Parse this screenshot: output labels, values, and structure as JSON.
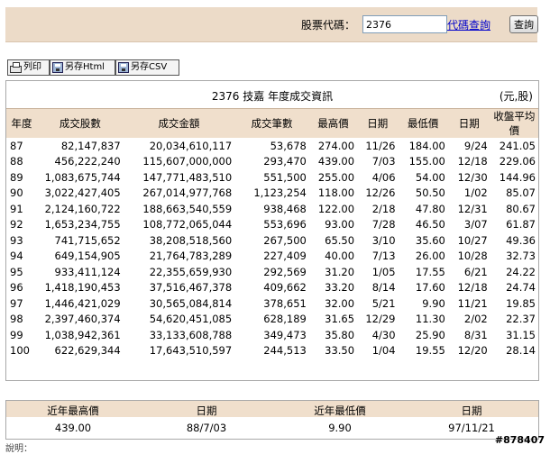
{
  "query": {
    "label": "股票代碼：",
    "value": "2376",
    "lookup_link": "代碼查詢",
    "submit": "查詢"
  },
  "toolbar": {
    "print": "列印",
    "save_html": "另存Html",
    "save_csv": "另存CSV"
  },
  "table": {
    "title": "2376 技嘉 年度成交資訊",
    "unit": "(元,股)",
    "columns": [
      "年度",
      "成交股數",
      "成交金額",
      "成交筆數",
      "最高價",
      "日期",
      "最低價",
      "日期",
      "收盤平均價"
    ],
    "rows": [
      [
        "87",
        "82,147,837",
        "20,034,610,117",
        "53,678",
        "274.00",
        "11/26",
        "184.00",
        "9/24",
        "241.05"
      ],
      [
        "88",
        "456,222,240",
        "115,607,000,000",
        "293,470",
        "439.00",
        "7/03",
        "155.00",
        "12/18",
        "229.06"
      ],
      [
        "89",
        "1,083,675,744",
        "147,771,483,510",
        "551,500",
        "255.00",
        "4/06",
        "54.00",
        "12/30",
        "144.96"
      ],
      [
        "90",
        "3,022,427,405",
        "267,014,977,768",
        "1,123,254",
        "118.00",
        "12/26",
        "50.50",
        "1/02",
        "85.07"
      ],
      [
        "91",
        "2,124,160,722",
        "188,663,540,559",
        "938,468",
        "122.00",
        "2/18",
        "47.80",
        "12/31",
        "80.67"
      ],
      [
        "92",
        "1,653,234,755",
        "108,772,065,044",
        "553,696",
        "93.00",
        "7/28",
        "46.50",
        "3/07",
        "61.87"
      ],
      [
        "93",
        "741,715,652",
        "38,208,518,560",
        "267,500",
        "65.50",
        "3/10",
        "35.60",
        "10/27",
        "49.36"
      ],
      [
        "94",
        "649,154,905",
        "21,764,783,289",
        "227,409",
        "40.00",
        "7/13",
        "26.00",
        "10/28",
        "32.73"
      ],
      [
        "95",
        "933,411,124",
        "22,355,659,930",
        "292,569",
        "31.20",
        "1/05",
        "17.55",
        "6/21",
        "24.22"
      ],
      [
        "96",
        "1,418,190,453",
        "37,516,467,378",
        "409,662",
        "33.20",
        "8/14",
        "17.60",
        "12/18",
        "24.74"
      ],
      [
        "97",
        "1,446,421,029",
        "30,565,084,814",
        "378,651",
        "32.00",
        "5/21",
        "9.90",
        "11/21",
        "19.85"
      ],
      [
        "98",
        "2,397,460,374",
        "54,620,451,085",
        "628,189",
        "31.65",
        "12/29",
        "11.30",
        "2/02",
        "22.37"
      ],
      [
        "99",
        "1,038,942,361",
        "33,133,608,788",
        "349,473",
        "35.80",
        "4/30",
        "25.90",
        "8/31",
        "31.15"
      ],
      [
        "100",
        "622,629,344",
        "17,643,510,597",
        "244,513",
        "33.50",
        "1/04",
        "19.55",
        "12/20",
        "28.14"
      ]
    ]
  },
  "summary": {
    "headers": [
      "近年最高價",
      "日期",
      "近年最低價",
      "日期"
    ],
    "values": [
      "439.00",
      "88/7/03",
      "9.90",
      "97/11/21"
    ]
  },
  "watermark": "#878407",
  "footnote": "說明："
}
